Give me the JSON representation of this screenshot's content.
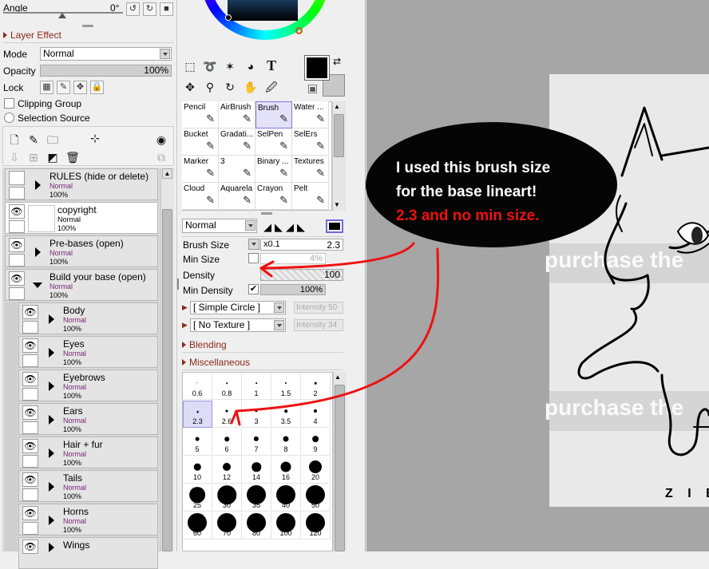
{
  "left_panel": {
    "angle_label": "Angle",
    "angle_value": "0°",
    "layer_effect_label": "Layer Effect",
    "mode_label": "Mode",
    "mode_value": "Normal",
    "opacity_label": "Opacity",
    "opacity_value": "100%",
    "lock_label": "Lock",
    "clipping_group_label": "Clipping Group",
    "selection_source_label": "Selection Source",
    "layers": [
      {
        "name": "RULES (hide or delete)",
        "mode": "Normal",
        "pct": "100%",
        "type": "folder-closed",
        "visible": false
      },
      {
        "name": "copyright",
        "mode": "Normal",
        "pct": "100%",
        "type": "layer",
        "visible": true
      },
      {
        "name": "Pre-bases (open)",
        "mode": "Normal",
        "pct": "100%",
        "type": "folder-closed",
        "visible": true
      },
      {
        "name": "Build your base (open)",
        "mode": "Normal",
        "pct": "100%",
        "type": "folder-open",
        "visible": true
      },
      {
        "name": "Body",
        "mode": "Normal",
        "pct": "100%",
        "type": "folder-closed",
        "visible": true
      },
      {
        "name": "Eyes",
        "mode": "Normal",
        "pct": "100%",
        "type": "folder-closed",
        "visible": true
      },
      {
        "name": "Eyebrows",
        "mode": "Normal",
        "pct": "100%",
        "type": "folder-closed",
        "visible": true
      },
      {
        "name": "Ears",
        "mode": "Normal",
        "pct": "100%",
        "type": "folder-closed",
        "visible": true
      },
      {
        "name": "Hair + fur",
        "mode": "Normal",
        "pct": "100%",
        "type": "folder-closed",
        "visible": true
      },
      {
        "name": "Tails",
        "mode": "Normal",
        "pct": "100%",
        "type": "folder-closed",
        "visible": true
      },
      {
        "name": "Horns",
        "mode": "Normal",
        "pct": "100%",
        "type": "folder-closed",
        "visible": true
      },
      {
        "name": "Wings",
        "mode": "",
        "pct": "",
        "type": "folder-closed",
        "visible": true
      }
    ]
  },
  "brushes": [
    {
      "name": "Pencil",
      "icon": "pencil-icon"
    },
    {
      "name": "AirBrush",
      "icon": "airbrush-icon"
    },
    {
      "name": "Brush",
      "icon": "brush-icon",
      "selected": true
    },
    {
      "name": "Water ...",
      "icon": "water-icon"
    },
    {
      "name": "Bucket",
      "icon": "bucket-icon"
    },
    {
      "name": "Gradati...",
      "icon": "gradation-icon"
    },
    {
      "name": "SelPen",
      "icon": "selpen-icon"
    },
    {
      "name": "SelErs",
      "icon": "selers-icon"
    },
    {
      "name": "Marker",
      "icon": "marker-icon"
    },
    {
      "name": "3",
      "icon": "eraser-icon"
    },
    {
      "name": "Binary ...",
      "icon": "binary-icon"
    },
    {
      "name": "Textures",
      "icon": "textures-icon"
    },
    {
      "name": "Cloud",
      "icon": "cloud-icon"
    },
    {
      "name": "Aquarela",
      "icon": "aquarela-icon"
    },
    {
      "name": "Crayon",
      "icon": "crayon-icon"
    },
    {
      "name": "Pelt",
      "icon": "pelt-icon"
    }
  ],
  "brush_settings": {
    "blend_mode": "Normal",
    "brush_size_label": "Brush Size",
    "size_multiplier": "x0.1",
    "brush_size_value": "2.3",
    "min_size_label": "Min Size",
    "min_size_value": "4%",
    "density_label": "Density",
    "density_value": "100",
    "min_density_label": "Min Density",
    "min_density_value": "100%",
    "shape": "[ Simple Circle ]",
    "shape_intensity": "Intensity 50",
    "texture": "[ No Texture ]",
    "texture_intensity": "Intensity 34",
    "blending_label": "Blending",
    "misc_label": "Miscellaneous"
  },
  "sizes": [
    "0.6",
    "0.8",
    "1",
    "1.5",
    "2",
    "2.3",
    "2.6",
    "3",
    "3.5",
    "4",
    "5",
    "6",
    "7",
    "8",
    "9",
    "10",
    "12",
    "14",
    "16",
    "20",
    "25",
    "30",
    "35",
    "40",
    "50",
    "60",
    "70",
    "80",
    "100",
    "120"
  ],
  "selected_size": "2.3",
  "annotation": {
    "line1": "I used this brush size",
    "line2": "for the base lineart!",
    "line3": "2.3 and no min size."
  },
  "canvas": {
    "watermark": "purchase the",
    "logo": "Z I B"
  },
  "colors": {
    "accent_red": "#ee1111",
    "section_head": "#8b2a1a",
    "blend_mode_text": "#7a2378"
  }
}
